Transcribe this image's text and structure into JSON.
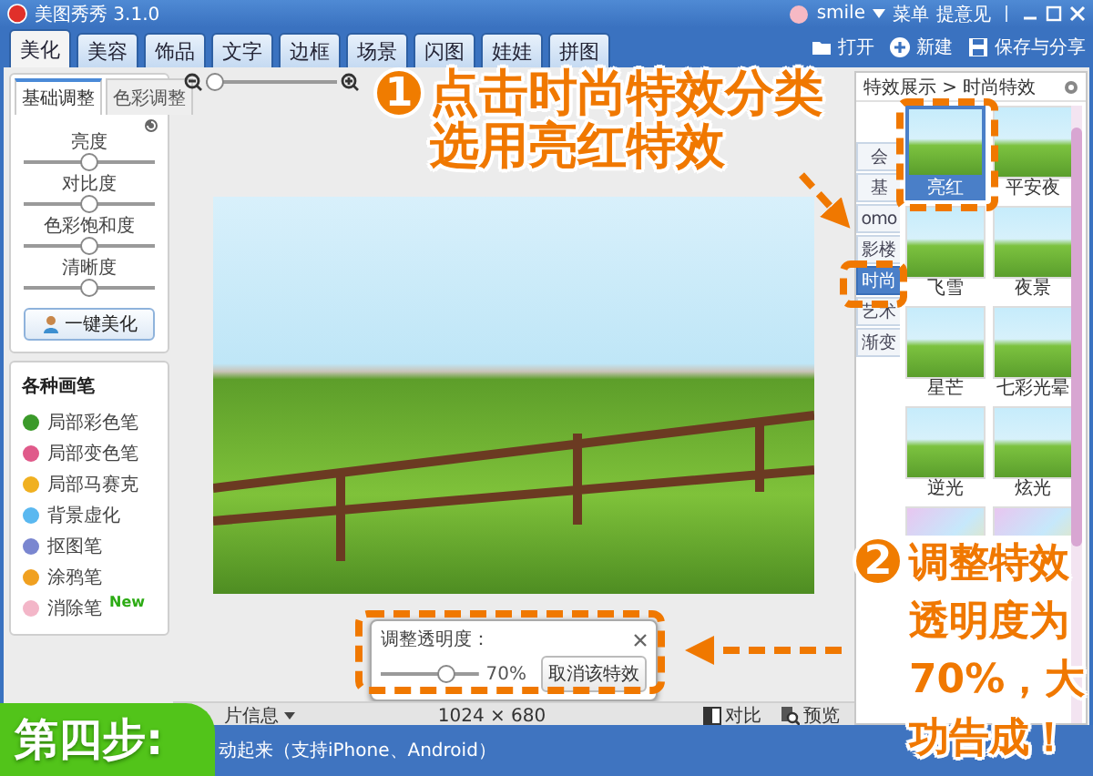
{
  "window": {
    "title": "美图秀秀 3.1.0",
    "user": "smile",
    "links": [
      "菜单",
      "提意见"
    ]
  },
  "main_tabs": [
    {
      "label": "美化",
      "selected": true
    },
    {
      "label": "美容",
      "selected": false
    },
    {
      "label": "饰品",
      "selected": false
    },
    {
      "label": "文字",
      "selected": false
    },
    {
      "label": "边框",
      "selected": false
    },
    {
      "label": "场景",
      "selected": false
    },
    {
      "label": "闪图",
      "selected": false
    },
    {
      "label": "娃娃",
      "selected": false
    },
    {
      "label": "拼图",
      "selected": false
    }
  ],
  "toolbar": [
    {
      "kind": "open",
      "label": "打开"
    },
    {
      "kind": "new",
      "label": "新建"
    },
    {
      "kind": "save",
      "label": "保存与分享"
    }
  ],
  "adjust_panel": {
    "tabs": [
      {
        "label": "基础调整",
        "selected": true
      },
      {
        "label": "色彩调整",
        "selected": false
      }
    ],
    "sliders": [
      {
        "label": "亮度",
        "level": 0.5
      },
      {
        "label": "对比度",
        "level": 0.5
      },
      {
        "label": "色彩饱和度",
        "level": 0.5
      },
      {
        "label": "清晰度",
        "level": 0.5
      }
    ],
    "button": "一键美化"
  },
  "brush_panel": {
    "title": "各种画笔",
    "items": [
      {
        "label": "局部彩色笔"
      },
      {
        "label": "局部变色笔"
      },
      {
        "label": "局部马赛克"
      },
      {
        "label": "背景虚化"
      },
      {
        "label": "抠图笔"
      },
      {
        "label": "涂鸦笔"
      },
      {
        "label": "消除笔",
        "badge": "New"
      }
    ]
  },
  "zoom": {
    "level": 0
  },
  "opacity_popup": {
    "title": "调整透明度：",
    "level": 0.7,
    "reading": "70%",
    "button": "取消该特效"
  },
  "image_info": {
    "menu": "片信息",
    "size": "1024 × 680",
    "buttons": [
      {
        "kind": "compare",
        "label": "对比"
      },
      {
        "kind": "preview",
        "label": "预览"
      }
    ]
  },
  "effects_panel": {
    "breadcrumb": "特效展示 > 时尚特效",
    "categories": [
      {
        "label": "会",
        "selected": false
      },
      {
        "label": "基",
        "selected": false
      },
      {
        "label": "omo",
        "selected": false
      },
      {
        "label": "影楼",
        "selected": false
      },
      {
        "label": "时尚",
        "selected": true
      },
      {
        "label": "艺术",
        "selected": false
      },
      {
        "label": "渐变",
        "selected": false
      }
    ],
    "effects": [
      {
        "label": "亮红",
        "selected": true
      },
      {
        "label": "平安夜",
        "selected": false
      },
      {
        "label": "飞雪",
        "selected": false
      },
      {
        "label": "夜景",
        "selected": false
      },
      {
        "label": "星芒",
        "selected": false
      },
      {
        "label": "七彩光晕",
        "selected": false
      },
      {
        "label": "逆光",
        "selected": false
      },
      {
        "label": "炫光",
        "selected": false
      }
    ]
  },
  "status_bar": "动起来（支持iPhone、Android）",
  "annotations": [
    {
      "number": "1",
      "lines": [
        "点击时尚特效分类",
        "选用亮红特效"
      ]
    },
    {
      "number": "2",
      "lines": [
        "调整特效",
        "透明度为",
        "70%，大",
        "功告成！"
      ]
    }
  ],
  "step_badge": "第四步:"
}
